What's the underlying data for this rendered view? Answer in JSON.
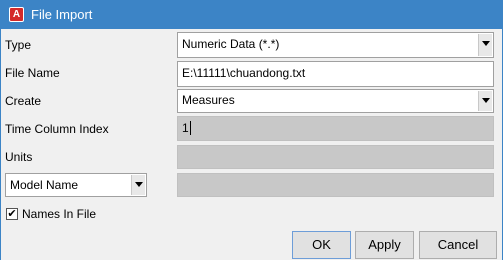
{
  "window": {
    "app_icon_letter": "A",
    "title": "File Import"
  },
  "form": {
    "type": {
      "label": "Type",
      "value": "Numeric Data (*.*)"
    },
    "file_name": {
      "label": "File Name",
      "value": "E:\\11111\\chuandong.txt"
    },
    "create": {
      "label": "Create",
      "value": "Measures"
    },
    "time_column_index": {
      "label": "Time Column Index",
      "value": "1"
    },
    "units": {
      "label": "Units",
      "value": ""
    },
    "model_name": {
      "selected": "Model Name",
      "value": ""
    },
    "names_in_file": {
      "label": "Names In File",
      "checked": true,
      "mark": "✔"
    }
  },
  "buttons": {
    "ok": "OK",
    "apply": "Apply",
    "cancel": "Cancel"
  },
  "icons": {
    "app": "adams-app-icon",
    "dropdown": "chevron-down-icon",
    "check": "checkmark-icon"
  },
  "colors": {
    "titlebar": "#3c84c6",
    "app_icon": "#d42a2a",
    "disabled_field": "#c8c8c8"
  }
}
